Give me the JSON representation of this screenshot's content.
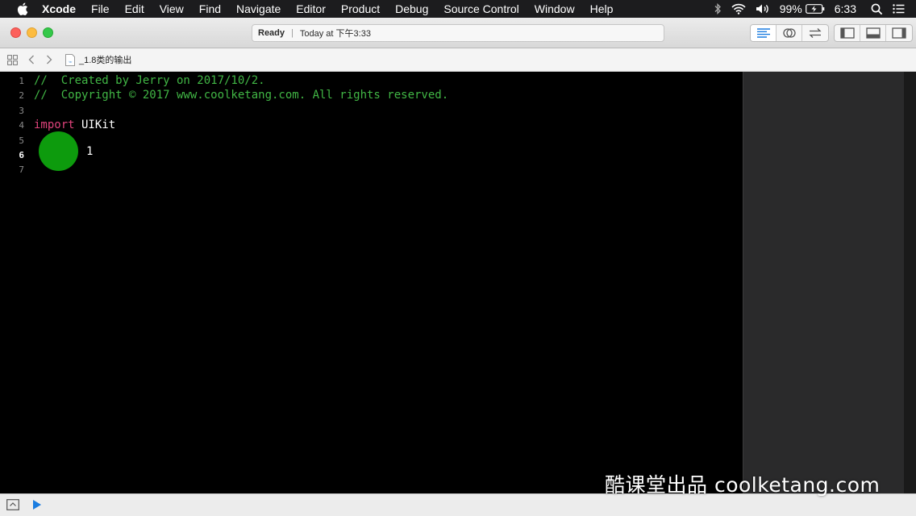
{
  "menubar": {
    "app_name": "Xcode",
    "menus": [
      "File",
      "Edit",
      "View",
      "Find",
      "Navigate",
      "Editor",
      "Product",
      "Debug",
      "Source Control",
      "Window",
      "Help"
    ],
    "battery": "99%",
    "clock": "6:33",
    "icons": [
      "apple-icon",
      "bluetooth-icon",
      "wifi-icon",
      "volume-icon",
      "battery-icon",
      "spotlight-icon",
      "notification-center-icon"
    ]
  },
  "toolbar": {
    "status": "Ready",
    "timestamp": "Today at 下午3:33",
    "editor_modes": [
      "standard-editor-icon",
      "assistant-editor-icon",
      "version-editor-icon"
    ],
    "panels": [
      "navigator-panel-icon",
      "debug-area-icon",
      "utilities-panel-icon"
    ],
    "accent": "#1a7ce0"
  },
  "jumpbar": {
    "filename": "_1.8类的输出"
  },
  "editor": {
    "lines": [
      {
        "num": "1",
        "tokens": [
          {
            "t": "//  Created by Jerry on 2017/10/2.",
            "k": "comment"
          }
        ]
      },
      {
        "num": "2",
        "tokens": [
          {
            "t": "//  Copyright © 2017 www.coolketang.com. All rights reserved.",
            "k": "comment"
          }
        ]
      },
      {
        "num": "3",
        "tokens": []
      },
      {
        "num": "4",
        "tokens": [
          {
            "t": "import",
            "k": "keyword"
          },
          {
            "t": " UIKit",
            "k": "plain"
          }
        ]
      },
      {
        "num": "5",
        "tokens": []
      },
      {
        "num": "6",
        "tokens": [],
        "current": true
      },
      {
        "num": "7",
        "tokens": []
      }
    ],
    "result_value": "1",
    "colors": {
      "comment": "#41b645",
      "keyword": "#e0437c",
      "plain": "#ffffff",
      "indicator": "#0d9b0d"
    }
  },
  "watermark": "酷课堂出品 coolketang.com"
}
